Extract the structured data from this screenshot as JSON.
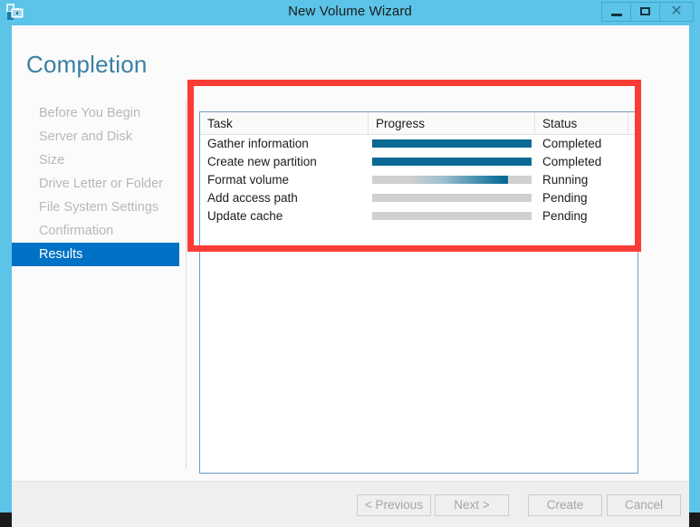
{
  "window": {
    "title": "New Volume Wizard",
    "icon": "volume-wizard-icon",
    "controls": {
      "minimize_label": "–",
      "maximize_label": "□",
      "close_label": "✕"
    }
  },
  "page": {
    "title": "Completion"
  },
  "sidebar": {
    "items": [
      {
        "label": "Before You Begin",
        "selected": false
      },
      {
        "label": "Server and Disk",
        "selected": false
      },
      {
        "label": "Size",
        "selected": false
      },
      {
        "label": "Drive Letter or Folder",
        "selected": false
      },
      {
        "label": "File System Settings",
        "selected": false
      },
      {
        "label": "Confirmation",
        "selected": false
      },
      {
        "label": "Results",
        "selected": true
      }
    ]
  },
  "table": {
    "columns": [
      "Task",
      "Progress",
      "Status"
    ],
    "rows": [
      {
        "task": "Gather information",
        "progress": 100,
        "progress_style": "solid",
        "status": "Completed"
      },
      {
        "task": "Create new partition",
        "progress": 100,
        "progress_style": "solid",
        "status": "Completed"
      },
      {
        "task": "Format volume",
        "progress": 85,
        "progress_style": "marquee",
        "status": "Running"
      },
      {
        "task": "Add access path",
        "progress": 0,
        "progress_style": "empty",
        "status": "Pending"
      },
      {
        "task": "Update cache",
        "progress": 0,
        "progress_style": "empty",
        "status": "Pending"
      }
    ]
  },
  "footer": {
    "buttons": [
      {
        "label": "< Previous",
        "enabled": false
      },
      {
        "label": "Next >",
        "enabled": false
      },
      {
        "label": "Create",
        "enabled": false
      },
      {
        "label": "Cancel",
        "enabled": false
      }
    ]
  },
  "annotation": {
    "shape": "rectangle",
    "color": "#fb3b35"
  },
  "colors": {
    "titlebar": "#5bc4e8",
    "accent_selected": "#0072c6",
    "heading": "#3a7fa5",
    "progress_fill": "#0a6a94",
    "progress_track": "#d0d0d0",
    "annotation": "#fb3b35"
  }
}
